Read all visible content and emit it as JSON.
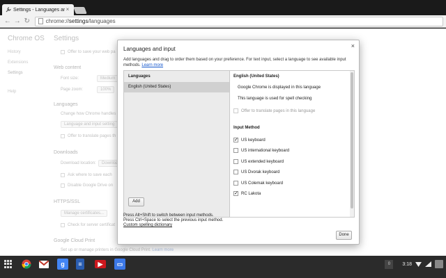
{
  "browser": {
    "tab_title": "Settings - Languages and",
    "url_prefix": "chrome://",
    "url_host": "settings",
    "url_path": "/languages"
  },
  "settings_page": {
    "brand": "Chrome OS",
    "nav": [
      "History",
      "Extensions",
      "Settings",
      "Help"
    ],
    "title": "Settings",
    "offer_save_passwords": "Offer to save your web pa",
    "web_content": {
      "heading": "Web content",
      "font_size_label": "Font size:",
      "font_size_value": "Medium",
      "page_zoom_label": "Page zoom:",
      "page_zoom_value": "100%"
    },
    "languages": {
      "heading": "Languages",
      "text": "Change how Chrome handles",
      "button": "Language and input setting",
      "offer_translate": "Offer to translate pages th"
    },
    "downloads": {
      "heading": "Downloads",
      "location_label": "Download location:",
      "location_value": "Downloa",
      "ask_where": "Ask where to save each",
      "disable_drive": "Disable Google Drive on"
    },
    "https": {
      "heading": "HTTPS/SSL",
      "button": "Manage certificates...",
      "check_revocation": "Check for server certificat"
    },
    "cloud_print": {
      "heading": "Google Cloud Print",
      "text": "Set up or manage printers in Google Cloud Print.",
      "link": "Learn more"
    }
  },
  "dialog": {
    "title": "Languages and input",
    "close_glyph": "×",
    "description": "Add languages and drag to order them based on your preference. For text input, select a language to see available input methods.",
    "learn_more": "Learn more",
    "languages_header": "Languages",
    "languages": [
      "English (United States)"
    ],
    "add_button": "Add",
    "selected_language": "English (United States)",
    "display_line": "Google Chrome is displayed in this language",
    "spell_line": "This language is used for spell checking",
    "offer_translate": "Offer to translate pages in this language",
    "input_method_header": "Input Method",
    "input_methods": [
      {
        "label": "US keyboard",
        "checked": true
      },
      {
        "label": "US international keyboard",
        "checked": false
      },
      {
        "label": "US extended keyboard",
        "checked": false
      },
      {
        "label": "US Dvorak keyboard",
        "checked": false
      },
      {
        "label": "US Colemak keyboard",
        "checked": false
      },
      {
        "label": "RC Lakota",
        "checked": true
      }
    ],
    "footer_line1": "Press Alt+Shift to switch between input methods.",
    "footer_line2": "Press Ctrl+Space to select the previous input method.",
    "custom_dictionary": "Custom spelling dictionary",
    "done_button": "Done"
  },
  "shelf": {
    "notification_count": "0",
    "clock": "3:18",
    "apps": [
      {
        "name": "chrome",
        "color": "#db4437"
      },
      {
        "name": "gmail",
        "color": "#c0392b"
      },
      {
        "name": "google-search",
        "color": "#4285f4"
      },
      {
        "name": "docs",
        "color": "#2a5db0"
      },
      {
        "name": "youtube",
        "color": "#cc181e"
      },
      {
        "name": "files",
        "color": "#3b78e7"
      }
    ]
  },
  "colors": {
    "link": "#1155cc",
    "selection": "#d0d0d0",
    "shelf": "#2b2b2b"
  }
}
